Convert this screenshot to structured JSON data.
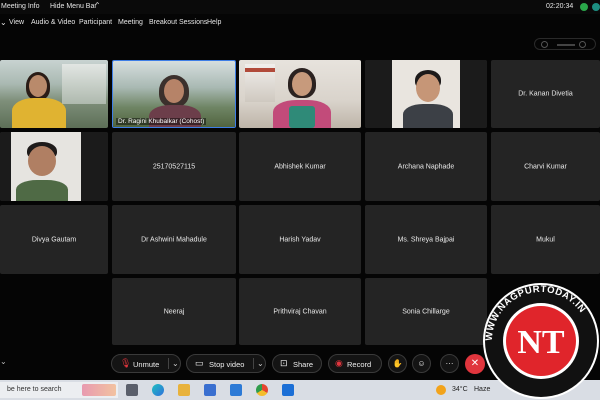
{
  "window": {
    "meeting_info": "Meeting Info",
    "hide_menu_bar": "Hide Menu Bar",
    "clock": "02:20:34"
  },
  "menu": {
    "items": [
      "View",
      "Audio & Video",
      "Participant",
      "Meeting",
      "Breakout Sessions",
      "Help"
    ]
  },
  "tiles": [
    {
      "name": "",
      "video": true
    },
    {
      "name": "Dr. Ragini Khubalkar (Cohost)",
      "video": true,
      "active": true
    },
    {
      "name": "",
      "video": true
    },
    {
      "name": "",
      "video": true
    },
    {
      "name": "Dr. Kanan Divetia",
      "video": false
    },
    {
      "name": "",
      "video": true
    },
    {
      "name": "25170527115",
      "video": false
    },
    {
      "name": "Abhishek Kumar",
      "video": false
    },
    {
      "name": "Archana Naphade",
      "video": false
    },
    {
      "name": "Charvi Kumar",
      "video": false
    },
    {
      "name": "Divya Gautam",
      "video": false
    },
    {
      "name": "Dr Ashwini Mahadule",
      "video": false
    },
    {
      "name": "Harish Yadav",
      "video": false
    },
    {
      "name": "Ms. Shreya Bajpai",
      "video": false
    },
    {
      "name": "Mukul",
      "video": false
    },
    {
      "name": "Neeraj",
      "video": false
    },
    {
      "name": "Prithviraj Chavan",
      "video": false
    },
    {
      "name": "Sonia Chillarge",
      "video": false
    }
  ],
  "toolbar": {
    "unmute": "Unmute",
    "stop_video": "Stop video",
    "share": "Share",
    "record": "Record",
    "more": "···",
    "leave": "✕"
  },
  "taskbar": {
    "search": "be here to search",
    "temperature": "34°C",
    "weather": "Haze"
  },
  "watermark": {
    "text": "WWW.NAGPURTODAY.IN",
    "logo": "NT"
  },
  "colors": {
    "accent": "#3e7ee6",
    "leave": "#e0353d",
    "record": "#e0353d",
    "watermark_red": "#e0252b"
  }
}
